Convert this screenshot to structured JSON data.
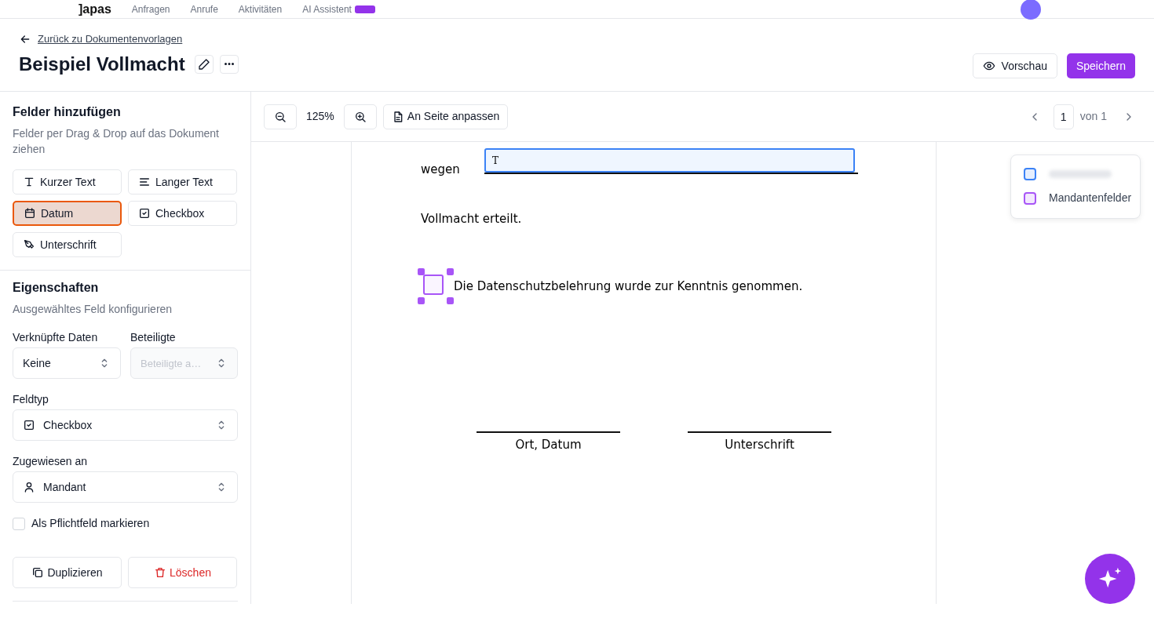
{
  "top_nav": {
    "logo": "]apas",
    "items": [
      {
        "label": "Anfragen",
        "badge": false
      },
      {
        "label": "Anrufe",
        "badge": false
      },
      {
        "label": "Aktivitäten",
        "badge": false
      },
      {
        "label": "AI Assistent",
        "badge": true
      }
    ]
  },
  "header": {
    "back_link": "Zurück zu Dokumentenvorlagen",
    "title": "Beispiel Vollmacht",
    "buttons": [
      {
        "label": "Vorschau",
        "kind": "outline"
      },
      {
        "label": "Speichern",
        "kind": "primary"
      }
    ]
  },
  "add_fields": {
    "title": "Felder hinzufügen",
    "description": "Felder per Drag & Drop auf das Dokument ziehen",
    "fields": [
      {
        "label": "Kurzer Text",
        "kind": "short-text",
        "selected": false
      },
      {
        "label": "Langer Text",
        "kind": "long-text",
        "selected": false
      },
      {
        "label": "Datum",
        "kind": "date",
        "selected": true
      },
      {
        "label": "Checkbox",
        "kind": "checkbox",
        "selected": false
      },
      {
        "label": "Unterschrift",
        "kind": "signature",
        "selected": false
      }
    ]
  },
  "properties": {
    "title": "Eigenschaften",
    "description": "Ausgewähltes Feld konfigurieren",
    "linked_data": {
      "label": "Verknüpfte Daten",
      "value": "Keine"
    },
    "participants": {
      "label": "Beteiligte",
      "placeholder": "Beteiligte a…",
      "disabled": true
    },
    "field_type": {
      "label": "Feldtyp",
      "value": "Checkbox"
    },
    "assigned_to": {
      "label": "Zugewiesen an",
      "value": "Mandant"
    },
    "required": {
      "label": "Als Pflichtfeld markieren",
      "checked": false
    },
    "actions": [
      {
        "label": "Duplizieren",
        "kind": "duplicate"
      },
      {
        "label": "Löschen",
        "kind": "delete"
      }
    ]
  },
  "toolbar": {
    "zoom": "125%",
    "fit": "An Seite anpassen",
    "page": "1",
    "page_of": "von 1"
  },
  "document": {
    "text_field": {
      "label": "wegen",
      "icon": "T",
      "active": true
    },
    "sentence": "Vollmacht erteilt.",
    "checkbox": {
      "label": "Die Datenschutzbelehrung wurde zur Kenntnis genommen.",
      "selected": true
    },
    "signatures": [
      "Ort, Datum",
      "Unterschrift"
    ]
  },
  "legend": [
    {
      "color": "#3b82f6"
    },
    {
      "label": "Mandantenfelder",
      "color": "#a855f7"
    }
  ]
}
